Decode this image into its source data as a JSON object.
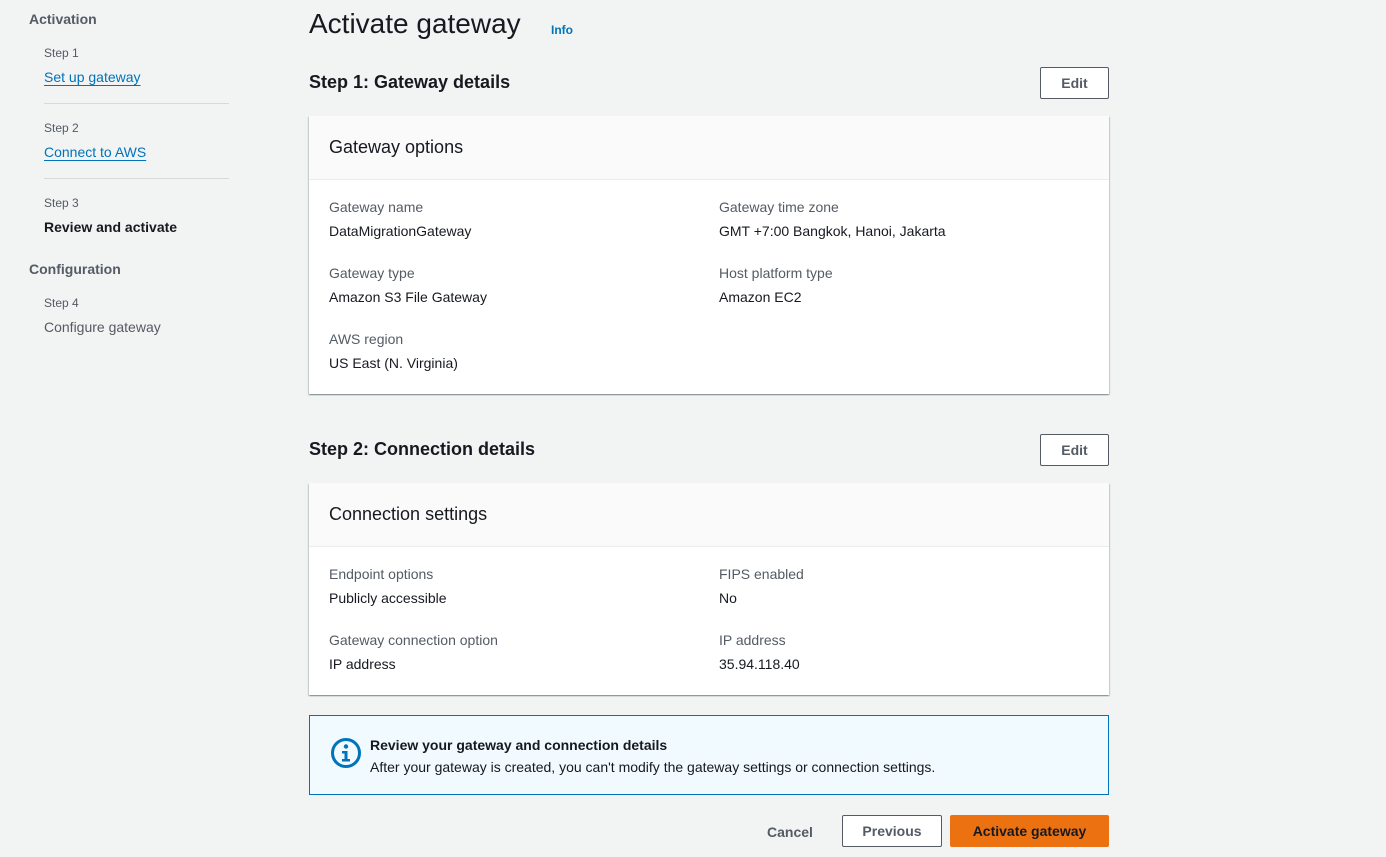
{
  "nav": {
    "activation_heading": "Activation",
    "configuration_heading": "Configuration",
    "steps": [
      {
        "step_label": "Step 1",
        "title": "Set up gateway"
      },
      {
        "step_label": "Step 2",
        "title": "Connect to AWS"
      },
      {
        "step_label": "Step 3",
        "title": "Review and activate"
      },
      {
        "step_label": "Step 4",
        "title": "Configure gateway"
      }
    ]
  },
  "page": {
    "title": "Activate gateway",
    "info_link": "Info"
  },
  "step1": {
    "heading": "Step 1: Gateway details",
    "edit_label": "Edit",
    "card_title": "Gateway options",
    "fields": {
      "gateway_name": {
        "key": "Gateway name",
        "value": "DataMigrationGateway"
      },
      "time_zone": {
        "key": "Gateway time zone",
        "value": "GMT +7:00 Bangkok, Hanoi, Jakarta"
      },
      "gateway_type": {
        "key": "Gateway type",
        "value": "Amazon S3 File Gateway"
      },
      "host_platform": {
        "key": "Host platform type",
        "value": "Amazon EC2"
      },
      "aws_region": {
        "key": "AWS region",
        "value": "US East (N. Virginia)"
      }
    }
  },
  "step2": {
    "heading": "Step 2: Connection details",
    "edit_label": "Edit",
    "card_title": "Connection settings",
    "fields": {
      "endpoint_options": {
        "key": "Endpoint options",
        "value": "Publicly accessible"
      },
      "fips_enabled": {
        "key": "FIPS enabled",
        "value": "No"
      },
      "connection_option": {
        "key": "Gateway connection option",
        "value": "IP address"
      },
      "ip_address": {
        "key": "IP address",
        "value": "35.94.118.40"
      }
    }
  },
  "alert": {
    "icon": "info-circle-icon",
    "title": "Review your gateway and connection details",
    "text": "After your gateway is created, you can't modify the gateway settings or connection settings."
  },
  "actions": {
    "cancel_label": "Cancel",
    "previous_label": "Previous",
    "activate_label": "Activate gateway"
  },
  "colors": {
    "link": "#0073bb",
    "primary_button": "#ec7211",
    "info_border": "#0073bb",
    "info_background": "#f1faff"
  }
}
